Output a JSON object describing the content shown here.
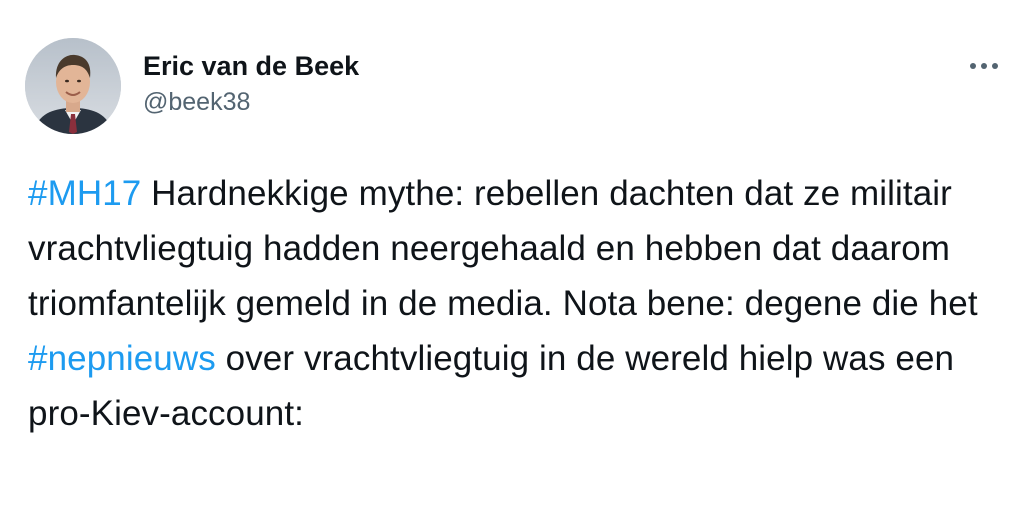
{
  "author": {
    "display_name": "Eric van de Beek",
    "handle": "@beek38"
  },
  "more_icon": "more-horizontal-icon",
  "tweet": {
    "hashtag_mh17": "#MH17",
    "text_1": " Hardnekkige mythe: rebellen dachten dat ze militair vrachtvliegtuig hadden neergehaald en hebben dat daarom triomfantelijk gemeld in de media. Nota bene: degene die het ",
    "hashtag_nepnieuws": "#nepnieuws",
    "text_2": " over vrachtvliegtuig in de wereld hielp was een pro-Kiev-account:"
  },
  "colors": {
    "hashtag": "#1d9bf0",
    "text": "#0f1419",
    "secondary": "#536471"
  }
}
